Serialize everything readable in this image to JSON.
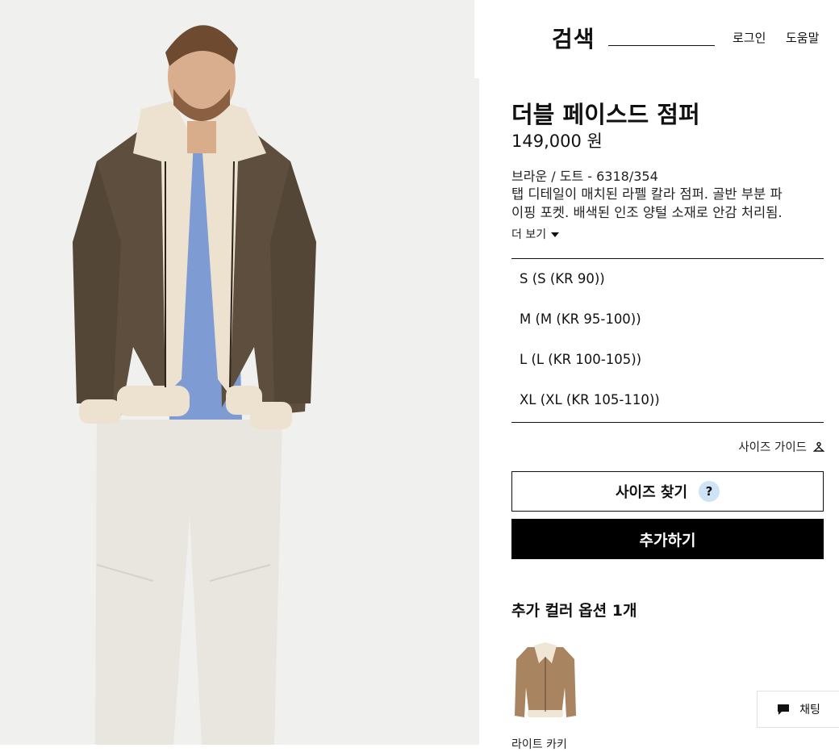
{
  "header": {
    "search_title": "검색",
    "search_placeholder": "",
    "login": "로그인",
    "help": "도움말"
  },
  "product": {
    "name": "더블 페이스드 점퍼",
    "price": "149,000 원",
    "color_ref": "브라운 / 도트 - 6318/354",
    "description_line1": "탭 디테일이 매치된 라펠 칼라 점퍼. 골반 부분 파",
    "description_line2": "이핑 포켓. 배색된 인조 양털 소재로 안감 처리됨.",
    "more": "더 보기"
  },
  "sizes": [
    {
      "label": "S (S (KR 90))"
    },
    {
      "label": "M (M (KR 95-100))"
    },
    {
      "label": "L (L (KR 100-105))"
    },
    {
      "label": "XL (XL (KR 105-110))"
    }
  ],
  "size_guide": "사이즈 가이드",
  "find_size": {
    "label": "사이즈 찾기",
    "help": "?"
  },
  "add_button": "추가하기",
  "color_options": {
    "title": "추가 컬러 옵션 1개",
    "swatch_label": "라이트 카키"
  },
  "chat": "채팅",
  "icons": {
    "more": "chevron-down-icon",
    "size_guide": "hanger-icon",
    "find_size_help": "question-icon",
    "chat": "chat-bubble-icon"
  },
  "colors": {
    "accent": "#000000",
    "help_badge": "#cfe3f6",
    "photo_bg": "#f1f1ef"
  }
}
